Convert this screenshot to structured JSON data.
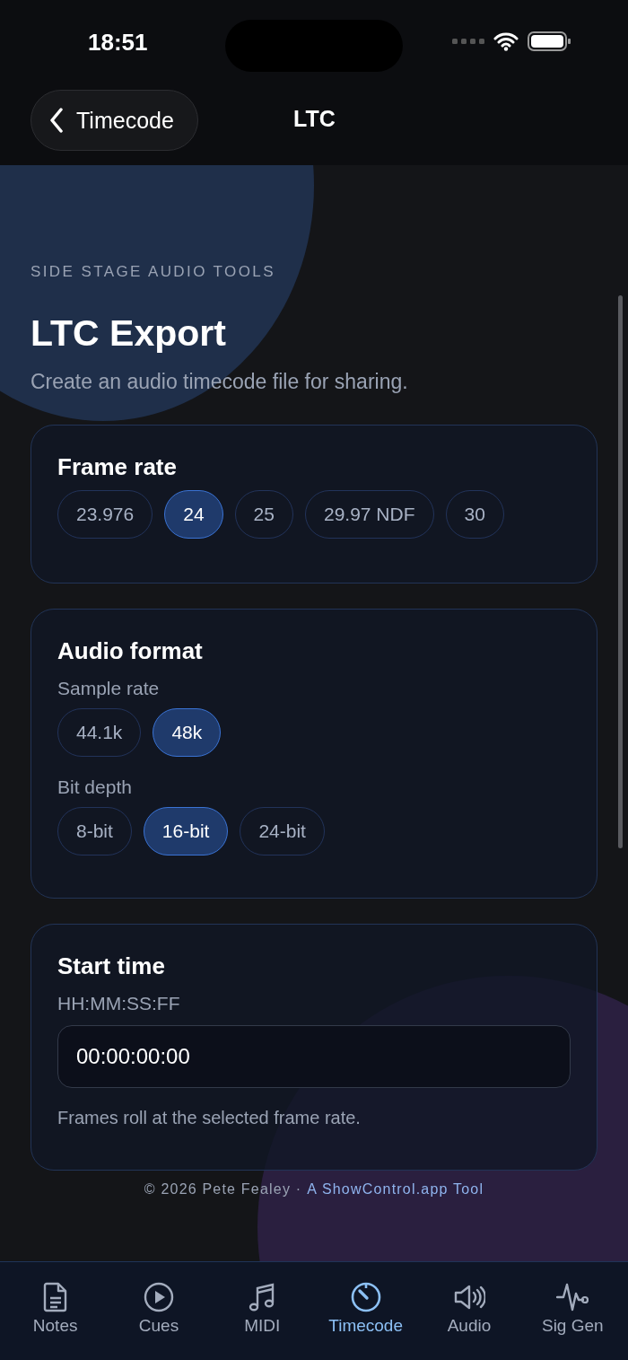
{
  "status_bar": {
    "time": "18:51"
  },
  "nav": {
    "back": "Timecode",
    "title": "LTC"
  },
  "header": {
    "eyebrow": "SIDE STAGE AUDIO TOOLS",
    "title": "LTC Export",
    "subtitle": "Create an audio timecode file for sharing."
  },
  "frame_rate": {
    "title": "Frame rate",
    "options": [
      {
        "label": "23.976",
        "selected": false
      },
      {
        "label": "24",
        "selected": true
      },
      {
        "label": "25",
        "selected": false
      },
      {
        "label": "29.97 NDF",
        "selected": false
      },
      {
        "label": "30",
        "selected": false
      }
    ]
  },
  "audio_format": {
    "title": "Audio format",
    "groups": [
      {
        "label": "Sample rate",
        "options": [
          {
            "label": "44.1k",
            "selected": false
          },
          {
            "label": "48k",
            "selected": true
          }
        ]
      },
      {
        "label": "Bit depth",
        "options": [
          {
            "label": "8-bit",
            "selected": false
          },
          {
            "label": "16-bit",
            "selected": true
          },
          {
            "label": "24-bit",
            "selected": false
          }
        ]
      }
    ]
  },
  "start_time": {
    "title": "Start time",
    "label": "HH:MM:SS:FF",
    "value": "00:00:00:00",
    "hint": "Frames roll at the selected frame rate."
  },
  "footer": {
    "text": "© 2026 Pete Fealey ·",
    "link": "A ShowControl.app Tool"
  },
  "tabs": [
    {
      "label": "Notes",
      "kind": "notes",
      "selected": false
    },
    {
      "label": "Cues",
      "kind": "cues",
      "selected": false
    },
    {
      "label": "MIDI",
      "kind": "midi",
      "selected": false
    },
    {
      "label": "Timecode",
      "kind": "timecode",
      "selected": true
    },
    {
      "label": "Audio",
      "kind": "audio",
      "selected": false
    },
    {
      "label": "Sig Gen",
      "kind": "siggen",
      "selected": false
    }
  ]
}
